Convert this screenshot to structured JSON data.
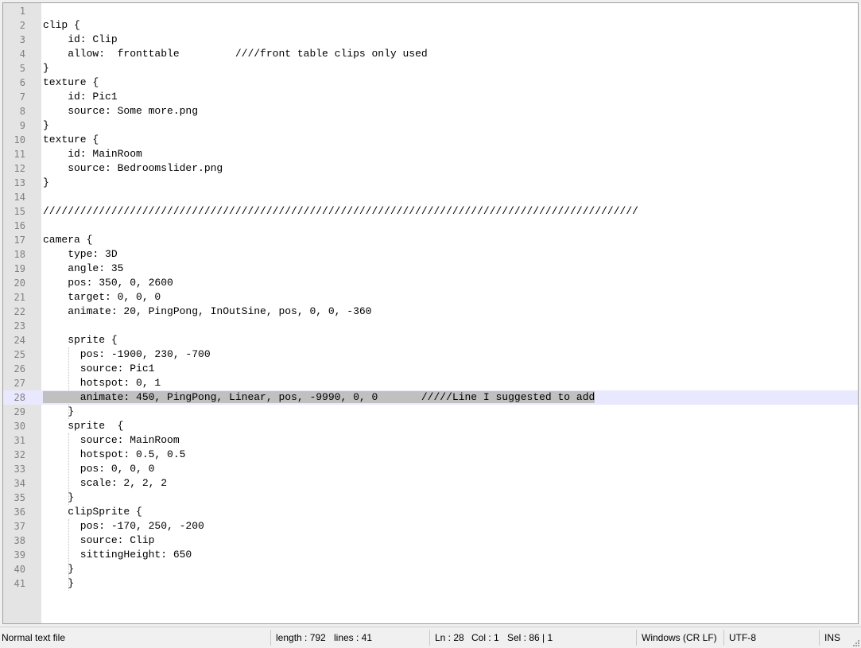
{
  "editor": {
    "lines": [
      {
        "n": "1",
        "text": ""
      },
      {
        "n": "2",
        "text": "clip {"
      },
      {
        "n": "3",
        "text": "    id: Clip"
      },
      {
        "n": "4",
        "text": "    allow:  fronttable         ////front table clips only used"
      },
      {
        "n": "5",
        "text": "}"
      },
      {
        "n": "6",
        "text": "texture {"
      },
      {
        "n": "7",
        "text": "    id: Pic1"
      },
      {
        "n": "8",
        "text": "    source: Some more.png"
      },
      {
        "n": "9",
        "text": "}"
      },
      {
        "n": "10",
        "text": "texture {"
      },
      {
        "n": "11",
        "text": "    id: MainRoom"
      },
      {
        "n": "12",
        "text": "    source: Bedroomslider.png"
      },
      {
        "n": "13",
        "text": "}"
      },
      {
        "n": "14",
        "text": ""
      },
      {
        "n": "15",
        "text": "////////////////////////////////////////////////////////////////////////////////////////////////"
      },
      {
        "n": "16",
        "text": ""
      },
      {
        "n": "17",
        "text": "camera {"
      },
      {
        "n": "18",
        "text": "    type: 3D"
      },
      {
        "n": "19",
        "text": "    angle: 35"
      },
      {
        "n": "20",
        "text": "    pos: 350, 0, 2600"
      },
      {
        "n": "21",
        "text": "    target: 0, 0, 0"
      },
      {
        "n": "22",
        "text": "    animate: 20, PingPong, InOutSine, pos, 0, 0, -360"
      },
      {
        "n": "23",
        "text": ""
      },
      {
        "n": "24",
        "text": "    sprite {"
      },
      {
        "n": "25",
        "text": "      pos: -1900, 230, -700"
      },
      {
        "n": "26",
        "text": "      source: Pic1"
      },
      {
        "n": "27",
        "text": "      hotspot: 0, 1"
      },
      {
        "n": "28",
        "text": "      animate: 450, PingPong, Linear, pos, -9990, 0, 0       /////Line I suggested to add"
      },
      {
        "n": "29",
        "text": "    }"
      },
      {
        "n": "30",
        "text": "    sprite  {"
      },
      {
        "n": "31",
        "text": "      source: MainRoom"
      },
      {
        "n": "32",
        "text": "      hotspot: 0.5, 0.5"
      },
      {
        "n": "33",
        "text": "      pos: 0, 0, 0"
      },
      {
        "n": "34",
        "text": "      scale: 2, 2, 2"
      },
      {
        "n": "35",
        "text": "    }"
      },
      {
        "n": "36",
        "text": "    clipSprite {"
      },
      {
        "n": "37",
        "text": "      pos: -170, 250, -200"
      },
      {
        "n": "38",
        "text": "      source: Clip"
      },
      {
        "n": "39",
        "text": "      sittingHeight: 650"
      },
      {
        "n": "40",
        "text": "    }"
      },
      {
        "n": "41",
        "text": "    }"
      }
    ],
    "current_line": "28"
  },
  "statusbar": {
    "file_type": "Normal text file",
    "length": "length : 792",
    "lines": "lines : 41",
    "ln": "Ln : 28",
    "col": "Col : 1",
    "sel": "Sel : 86 | 1",
    "eol": "Windows (CR LF)",
    "encoding": "UTF-8",
    "mode": "INS"
  },
  "colors": {
    "gutter_bg": "#e4e4e4",
    "current_line_bg": "#e8e8ff",
    "selection_bg": "#c0c0c0",
    "line_number": "#808080"
  }
}
